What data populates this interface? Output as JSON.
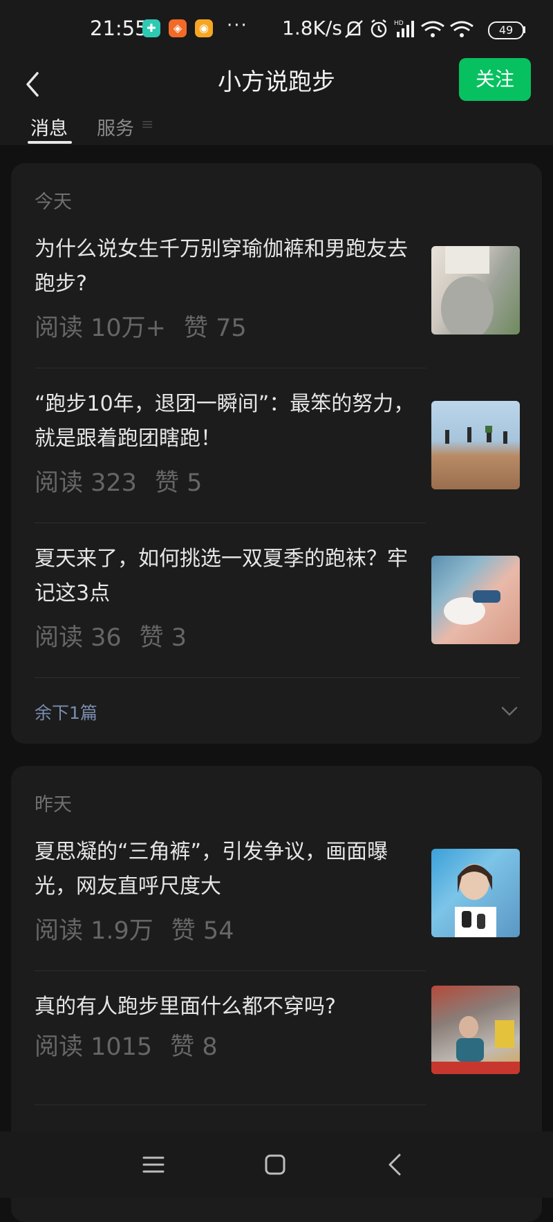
{
  "status_bar": {
    "time": "21:55",
    "app_icons": [
      "shield-app-icon",
      "orange-app-icon",
      "weibo-icon"
    ],
    "more": "···",
    "net_speed": "1.8K/s",
    "battery": "49"
  },
  "nav": {
    "title": "小方说跑步",
    "follow_label": "关注",
    "tabs": [
      {
        "label": "消息",
        "active": true
      },
      {
        "label": "服务",
        "active": false
      }
    ],
    "tab_extra": "≡"
  },
  "sections": [
    {
      "day": "今天",
      "articles": [
        {
          "title": "为什么说女生千万别穿瑜伽裤和男跑友去跑步?",
          "reads": "阅读 10万+",
          "likes": "赞 75"
        },
        {
          "title": "“跑步10年，退团一瞬间”：最笨的努力，就是跟着跑团瞎跑！",
          "reads": "阅读 323",
          "likes": "赞 5"
        },
        {
          "title": "夏天来了，如何挑选一双夏季的跑袜？牢记这3点",
          "reads": "阅读 36",
          "likes": "赞 3"
        }
      ],
      "more_label": "余下1篇"
    },
    {
      "day": "昨天",
      "articles": [
        {
          "title": "夏思凝的“三角裤”，引发争议，画面曝光，网友直呼尺度大",
          "reads": "阅读 1.9万",
          "likes": "赞 54"
        },
        {
          "title": "真的有人跑步里面什么都不穿吗?",
          "reads": "阅读 1015",
          "likes": "赞 8"
        }
      ]
    }
  ],
  "colors": {
    "background": "#111111",
    "card": "#1c1c1c",
    "accent_green": "#07c160",
    "link": "#7a8db0"
  }
}
